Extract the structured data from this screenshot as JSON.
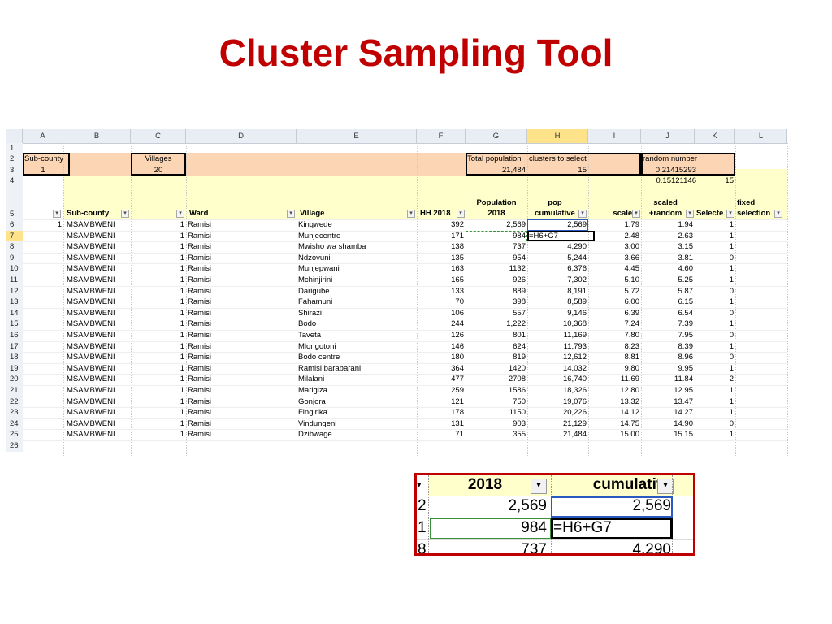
{
  "slide": {
    "title": "Cluster Sampling Tool"
  },
  "spreadsheet": {
    "columns": [
      "A",
      "B",
      "C",
      "D",
      "E",
      "F",
      "G",
      "H",
      "I",
      "J",
      "K",
      "L"
    ],
    "selected_column": "H",
    "row_numbers": [
      "1",
      "2",
      "3",
      "4",
      "5",
      "6",
      "7",
      "8",
      "9",
      "10",
      "11",
      "12",
      "13",
      "14",
      "15",
      "16",
      "17",
      "18",
      "19",
      "20",
      "21",
      "22",
      "23",
      "24",
      "25",
      "26"
    ],
    "selected_row": "7",
    "top": {
      "subcounty_label": "Sub-county",
      "subcounty_value": "1",
      "villages_label": "Villages",
      "villages_value": "20",
      "total_pop_label": "Total population",
      "total_pop_value": "21,484",
      "clusters_label": "clusters to select",
      "clusters_value": "15",
      "random_label": "random number",
      "random_value": "0.21415293",
      "row4_j": "0.15121146",
      "row4_k": "15"
    },
    "headers": {
      "sub_county": "Sub-county",
      "ward": "Ward",
      "village": "Village",
      "hh2018": "HH 2018",
      "population_l1": "Population",
      "population_l2": "2018",
      "pop_cum_l1": "pop",
      "pop_cum_l2": "cumulative",
      "scaled": "scaled",
      "scaled_rand_l1": "scaled",
      "scaled_rand_l2": "+random",
      "selected": "Selecte",
      "fixed_l1": "fixed",
      "fixed_l2": "selection"
    },
    "rows": [
      {
        "a": "1",
        "b": "MSAMBWENI",
        "c": "1",
        "d": "Ramisi",
        "e": "Kingwede",
        "f": "392",
        "g": "2,569",
        "h": "2,569",
        "i": "1.79",
        "j": "1.94",
        "k": "1"
      },
      {
        "a": "",
        "b": "MSAMBWENI",
        "c": "1",
        "d": "Ramisi",
        "e": "Munjecentre",
        "f": "171",
        "g": "984",
        "h": "=H6+G7",
        "i": "2.48",
        "j": "2.63",
        "k": "1"
      },
      {
        "a": "",
        "b": "MSAMBWENI",
        "c": "1",
        "d": "Ramisi",
        "e": "Mwisho wa shamba",
        "f": "138",
        "g": "737",
        "h": "4,290",
        "i": "3.00",
        "j": "3.15",
        "k": "1"
      },
      {
        "a": "",
        "b": "MSAMBWENI",
        "c": "1",
        "d": "Ramisi",
        "e": "Ndzovuni",
        "f": "135",
        "g": "954",
        "h": "5,244",
        "i": "3.66",
        "j": "3.81",
        "k": "0"
      },
      {
        "a": "",
        "b": "MSAMBWENI",
        "c": "1",
        "d": "Ramisi",
        "e": "Munjepwani",
        "f": "163",
        "g": "1132",
        "h": "6,376",
        "i": "4.45",
        "j": "4.60",
        "k": "1"
      },
      {
        "a": "",
        "b": "MSAMBWENI",
        "c": "1",
        "d": "Ramisi",
        "e": "Mchinjirini",
        "f": "165",
        "g": "926",
        "h": "7,302",
        "i": "5.10",
        "j": "5.25",
        "k": "1"
      },
      {
        "a": "",
        "b": "MSAMBWENI",
        "c": "1",
        "d": "Ramisi",
        "e": "Darigube",
        "f": "133",
        "g": "889",
        "h": "8,191",
        "i": "5.72",
        "j": "5.87",
        "k": "0"
      },
      {
        "a": "",
        "b": "MSAMBWENI",
        "c": "1",
        "d": "Ramisi",
        "e": "Fahamuni",
        "f": "70",
        "g": "398",
        "h": "8,589",
        "i": "6.00",
        "j": "6.15",
        "k": "1"
      },
      {
        "a": "",
        "b": "MSAMBWENI",
        "c": "1",
        "d": "Ramisi",
        "e": "Shirazi",
        "f": "106",
        "g": "557",
        "h": "9,146",
        "i": "6.39",
        "j": "6.54",
        "k": "0"
      },
      {
        "a": "",
        "b": "MSAMBWENI",
        "c": "1",
        "d": "Ramisi",
        "e": "Bodo",
        "f": "244",
        "g": "1,222",
        "h": "10,368",
        "i": "7.24",
        "j": "7.39",
        "k": "1"
      },
      {
        "a": "",
        "b": "MSAMBWENI",
        "c": "1",
        "d": "Ramisi",
        "e": "Taveta",
        "f": "126",
        "g": "801",
        "h": "11,169",
        "i": "7.80",
        "j": "7.95",
        "k": "0"
      },
      {
        "a": "",
        "b": "MSAMBWENI",
        "c": "1",
        "d": "Ramisi",
        "e": "Mlongotoni",
        "f": "146",
        "g": "624",
        "h": "11,793",
        "i": "8.23",
        "j": "8.39",
        "k": "1"
      },
      {
        "a": "",
        "b": "MSAMBWENI",
        "c": "1",
        "d": "Ramisi",
        "e": "Bodo centre",
        "f": "180",
        "g": "819",
        "h": "12,612",
        "i": "8.81",
        "j": "8.96",
        "k": "0"
      },
      {
        "a": "",
        "b": "MSAMBWENI",
        "c": "1",
        "d": "Ramisi",
        "e": "Ramisi barabarani",
        "f": "364",
        "g": "1420",
        "h": "14,032",
        "i": "9.80",
        "j": "9.95",
        "k": "1"
      },
      {
        "a": "",
        "b": "MSAMBWENI",
        "c": "1",
        "d": "Ramisi",
        "e": "Milalani",
        "f": "477",
        "g": "2708",
        "h": "16,740",
        "i": "11.69",
        "j": "11.84",
        "k": "2"
      },
      {
        "a": "",
        "b": "MSAMBWENI",
        "c": "1",
        "d": "Ramisi",
        "e": "Marigiza",
        "f": "259",
        "g": "1586",
        "h": "18,326",
        "i": "12.80",
        "j": "12.95",
        "k": "1"
      },
      {
        "a": "",
        "b": "MSAMBWENI",
        "c": "1",
        "d": "Ramisi",
        "e": "Gonjora",
        "f": "121",
        "g": "750",
        "h": "19,076",
        "i": "13.32",
        "j": "13.47",
        "k": "1"
      },
      {
        "a": "",
        "b": "MSAMBWENI",
        "c": "1",
        "d": "Ramisi",
        "e": "Fingirika",
        "f": "178",
        "g": "1150",
        "h": "20,226",
        "i": "14.12",
        "j": "14.27",
        "k": "1"
      },
      {
        "a": "",
        "b": "MSAMBWENI",
        "c": "1",
        "d": "Ramisi",
        "e": "Vindungeni",
        "f": "131",
        "g": "903",
        "h": "21,129",
        "i": "14.75",
        "j": "14.90",
        "k": "0"
      },
      {
        "a": "",
        "b": "MSAMBWENI",
        "c": "1",
        "d": "Ramisi",
        "e": "Dzibwage",
        "f": "71",
        "g": "355",
        "h": "21,484",
        "i": "15.00",
        "j": "15.15",
        "k": "1"
      }
    ]
  },
  "zoom_inset": {
    "header_left": "2018",
    "header_right": "cumulative",
    "row_nums": [
      "2",
      "1",
      "8"
    ],
    "r1_left": "2,569",
    "r1_right": "2,569",
    "r2_left": "984",
    "r2_right": "=H6+G7",
    "r3_left": "737",
    "r3_right": "4,290"
  },
  "colors": {
    "title": "#c00000",
    "orange": "#fcd5b4",
    "yellow": "#ffffcc",
    "selected_header": "#ffe38a",
    "inset_border": "#c00000"
  }
}
